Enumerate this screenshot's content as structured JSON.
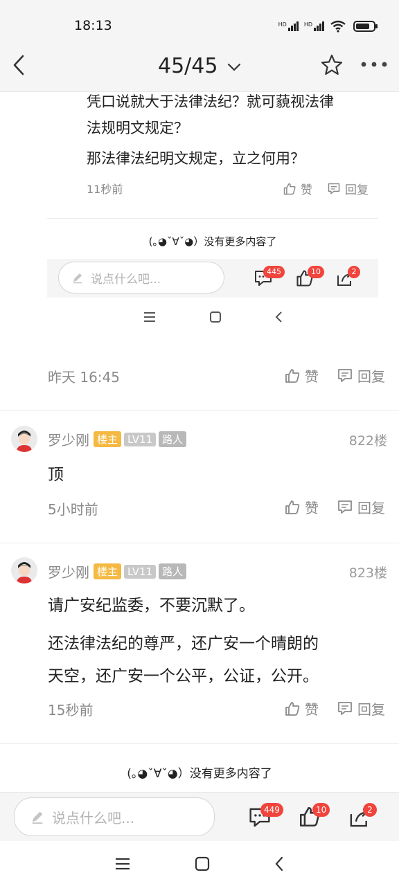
{
  "status_bar": {
    "time": "18:13",
    "hd1": "HD",
    "hd2": "HD"
  },
  "top_bar": {
    "page_indicator": "45/45"
  },
  "embedded": {
    "lines": [
      "凭口说就大于法律法纪？就可藐视法律",
      "法规明文规定？",
      "那法律法纪明文规定，立之何用？"
    ],
    "time": "11秒前",
    "like_label": "赞",
    "reply_label": "回复",
    "no_more": "(｡◕ˇ∀ˇ◕）没有更多内容了",
    "input_placeholder": "说点什么吧...",
    "comment_count": "445",
    "like_count": "10",
    "share_count": "2"
  },
  "post_prev": {
    "time": "昨天 16:45",
    "like_label": "赞",
    "reply_label": "回复"
  },
  "posts": [
    {
      "name": "罗少刚",
      "tag_owner": "楼主",
      "tag_level": "LV11",
      "tag_role": "路人",
      "floor": "822楼",
      "lines": [
        "顶"
      ],
      "time": "5小时前",
      "like_label": "赞",
      "reply_label": "回复"
    },
    {
      "name": "罗少刚",
      "tag_owner": "楼主",
      "tag_level": "LV11",
      "tag_role": "路人",
      "floor": "823楼",
      "lines": [
        "请广安纪监委，不要沉默了。",
        "还法律法纪的尊严，还广安一个晴朗的",
        "天空，还广安一个公平，公证，公开。"
      ],
      "time": "15秒前",
      "like_label": "赞",
      "reply_label": "回复"
    }
  ],
  "no_more": "(｡◕ˇ∀ˇ◕）没有更多内容了",
  "bottom_bar": {
    "input_placeholder": "说点什么吧...",
    "comment_count": "449",
    "like_count": "10",
    "share_count": "2"
  },
  "colors": {
    "accent_red": "#f0443c",
    "owner_tag": "#f5b942",
    "level_tag": "#c8c8c8"
  }
}
